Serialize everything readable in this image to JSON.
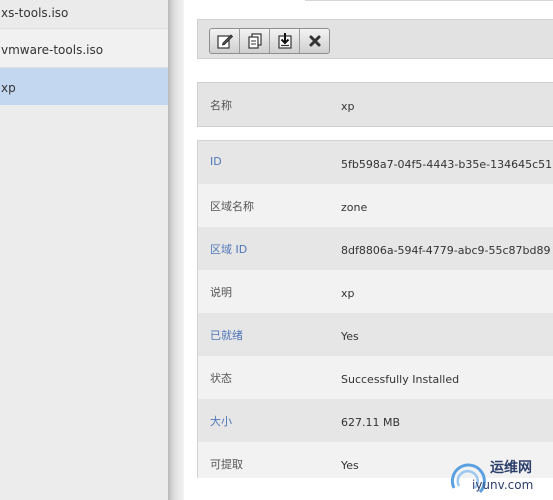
{
  "sidebar": {
    "items": [
      {
        "label": "xs-tools.iso"
      },
      {
        "label": "vmware-tools.iso"
      },
      {
        "label": "xp"
      }
    ]
  },
  "toolbar": {
    "buttons": [
      {
        "icon": "edit-icon"
      },
      {
        "icon": "copy-icon"
      },
      {
        "icon": "download-icon"
      },
      {
        "icon": "delete-icon"
      }
    ]
  },
  "name_field": {
    "label": "名称",
    "value": "xp"
  },
  "details": [
    {
      "label": "ID",
      "value": "5fb598a7-04f5-4443-b35e-134645c51"
    },
    {
      "label": "区域名称",
      "value": "zone"
    },
    {
      "label": "区域 ID",
      "value": "8df8806a-594f-4779-abc9-55c87bd89"
    },
    {
      "label": "说明",
      "value": "xp"
    },
    {
      "label": "已就绪",
      "value": "Yes"
    },
    {
      "label": "状态",
      "value": "Successfully Installed"
    },
    {
      "label": "大小",
      "value": "627.11 MB"
    },
    {
      "label": "可提取",
      "value": "Yes"
    }
  ],
  "watermark": {
    "cn": "运维网",
    "url": "iyunv.com"
  },
  "colors": {
    "selected": "#c3d7f0",
    "label_blue": "#4f76b8"
  }
}
